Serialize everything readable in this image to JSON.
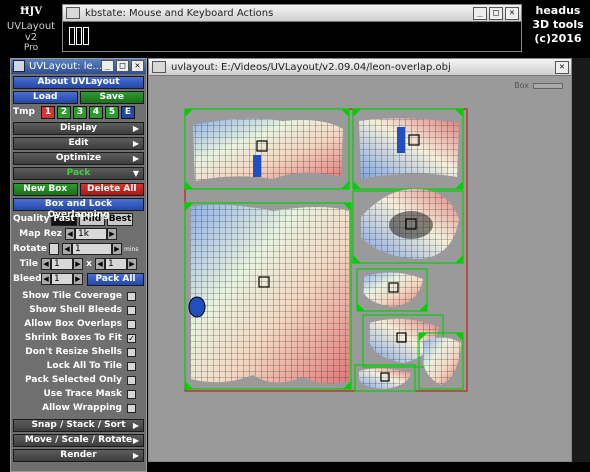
{
  "logo": {
    "mark": "ĦJV",
    "name": "UVLayout v2",
    "edition": "Pro"
  },
  "kbstate": {
    "title": "kbstate: Mouse and Keyboard Actions"
  },
  "brand": {
    "line1": "headus",
    "line2": "3D tools",
    "line3": "(c)2016"
  },
  "window_controls": {
    "minimize": "_",
    "maximize": "□",
    "close": "✕"
  },
  "panel": {
    "title": "UVLayout: le...",
    "about": "About UVLayout",
    "load": "Load",
    "save": "Save",
    "tmp_label": "Tmp",
    "tmp_slots": [
      "1",
      "2",
      "3",
      "4",
      "5",
      "E"
    ],
    "menus": [
      "Display",
      "Edit",
      "Optimize",
      "Pack"
    ],
    "new_box": "New Box",
    "delete_all": "Delete All",
    "box_lock": "Box and Lock Overlapping",
    "quality_label": "Quality",
    "quality_options": [
      "Fast",
      "Mid",
      "Best"
    ],
    "map_rez_label": "Map Rez",
    "map_rez_value": "1k",
    "rotate_label": "Rotate",
    "rotate_value": "1",
    "rotate_unit": "mins",
    "tile_label": "Tile",
    "tile_x": "1",
    "tile_sep": "x",
    "tile_y": "1",
    "bleed_label": "Bleed",
    "bleed_value": "1",
    "pack_all": "Pack All",
    "options": [
      {
        "label": "Show Tile Coverage",
        "checked": false
      },
      {
        "label": "Show Shell Bleeds",
        "checked": false
      },
      {
        "label": "Allow Box Overlaps",
        "checked": false
      },
      {
        "label": "Shrink Boxes To Fit",
        "checked": true
      },
      {
        "label": "Don't Resize Shells",
        "checked": false
      },
      {
        "label": "Lock All To Tile",
        "checked": false
      },
      {
        "label": "Pack Selected Only",
        "checked": false
      },
      {
        "label": "Use Trace Mask",
        "checked": false
      },
      {
        "label": "Allow Wrapping",
        "checked": false
      }
    ],
    "bottom_menus": [
      "Snap / Stack / Sort",
      "Move / Scale / Rotate",
      "Render"
    ]
  },
  "uvwindow": {
    "title": "uvlayout: E:/Videos/UVLayout/v2.09.04/leon-overlap.obj",
    "box_label": "Box"
  },
  "colors": {
    "blue_button": "#2447a8",
    "green_button": "#1b6f1b",
    "red_button": "#a81818",
    "shell_outline": "#00d000",
    "tile_border": "#d00000",
    "canvas_bg": "#9a9a9a"
  }
}
